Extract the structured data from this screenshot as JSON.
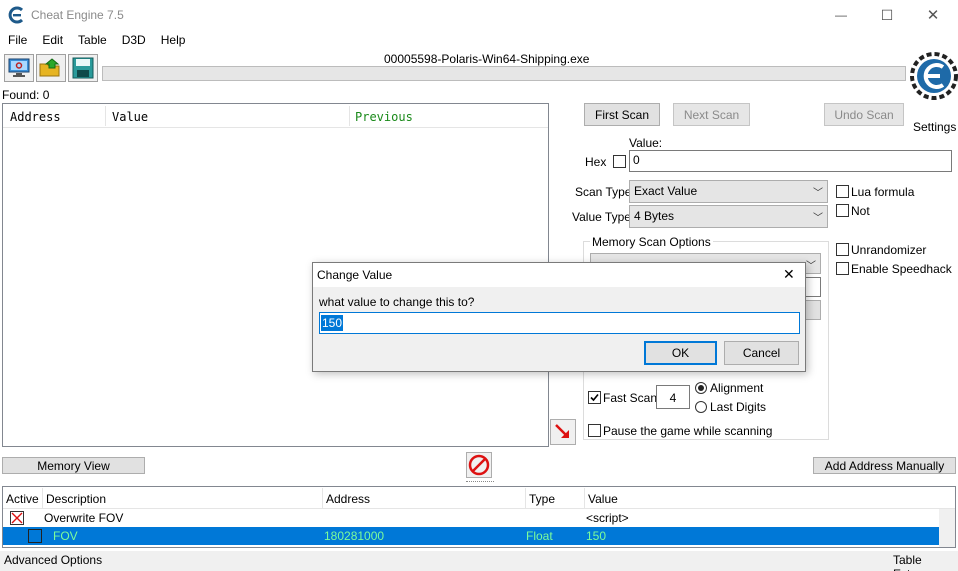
{
  "window": {
    "title": "Cheat Engine 7.5",
    "minimize_glyph": "—",
    "maximize_glyph": "☐",
    "close_glyph": "✕"
  },
  "menu": [
    "File",
    "Edit",
    "Table",
    "D3D",
    "Help"
  ],
  "toolbar": {
    "process_name": "00005598-Polaris-Win64-Shipping.exe",
    "icons": [
      "computer-icon",
      "open-folder-icon",
      "save-icon"
    ]
  },
  "found": "Found: 0",
  "results": {
    "columns": [
      "Address",
      "Value",
      "Previous"
    ],
    "previous_color": "#1a8a1a"
  },
  "scan": {
    "first_scan": "First Scan",
    "next_scan": "Next Scan",
    "undo_scan": "Undo Scan",
    "settings": "Settings",
    "value_label": "Value:",
    "hex_label": "Hex",
    "value": "0",
    "scan_type_label": "Scan Type",
    "scan_type": "Exact Value",
    "value_type_label": "Value Type",
    "value_type": "4 Bytes",
    "lua_formula": "Lua formula",
    "not": "Not",
    "unrandomizer": "Unrandomizer",
    "enable_speedhack": "Enable Speedhack",
    "memory_scan_options": "Memory Scan Options",
    "fast_scan": "Fast Scan",
    "fast_scan_value": "4",
    "alignment": "Alignment",
    "last_digits": "Last Digits",
    "pause_game": "Pause the game while scanning"
  },
  "bottom_bar": {
    "memory_view": "Memory View",
    "add_address": "Add Address Manually"
  },
  "address_table": {
    "columns": [
      "Active",
      "Description",
      "Address",
      "Type",
      "Value"
    ],
    "rows": [
      {
        "description": "Overwrite FOV",
        "address": "",
        "type": "",
        "value": "<script>"
      },
      {
        "description": "FOV",
        "address": "180281000",
        "type": "Float",
        "value": "150"
      }
    ],
    "selected_text_color": "#7CFC9A",
    "selected_bg": "#0078d7"
  },
  "status": {
    "advanced_options": "Advanced Options",
    "table_extras": "Table Extras"
  },
  "dialog": {
    "title": "Change Value",
    "close_glyph": "✕",
    "prompt": "what value to change this to?",
    "value": "150",
    "ok": "OK",
    "cancel": "Cancel"
  }
}
